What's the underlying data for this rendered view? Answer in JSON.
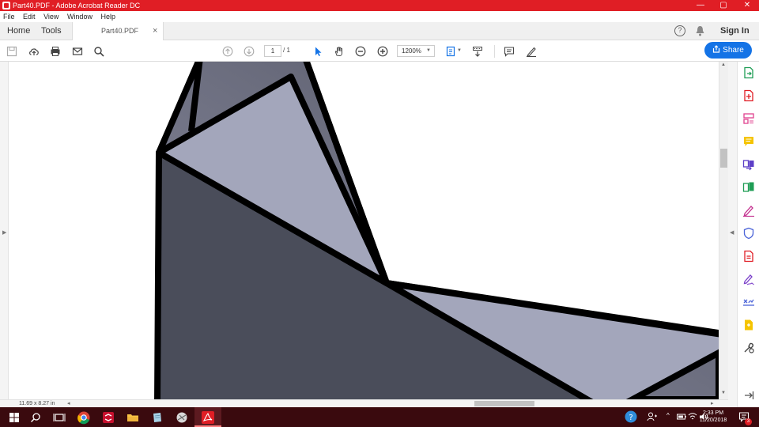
{
  "window": {
    "title": "Part40.PDF - Adobe Acrobat Reader DC",
    "minimize": "—",
    "maximize": "▢",
    "close": "✕"
  },
  "menu": {
    "items": [
      "File",
      "Edit",
      "View",
      "Window",
      "Help"
    ]
  },
  "tabs": {
    "home": "Home",
    "tools": "Tools",
    "document": "Part40.PDF",
    "document_close": "×",
    "help_glyph": "?",
    "sign_in": "Sign In"
  },
  "toolbar": {
    "page_current": "1",
    "page_total": "/ 1",
    "zoom": "1200%",
    "share": "Share"
  },
  "status": {
    "page_size": "11.69 x 8.27 in"
  },
  "taskbar": {
    "time": "2:33 PM",
    "date": "11/20/2018",
    "notification_count": "3"
  },
  "colors": {
    "titlebar": "#e01e25",
    "accent": "#1473e6",
    "shape_dark": "#4a4d5a",
    "shape_light": "#a3a6bb",
    "outline": "#000000"
  }
}
